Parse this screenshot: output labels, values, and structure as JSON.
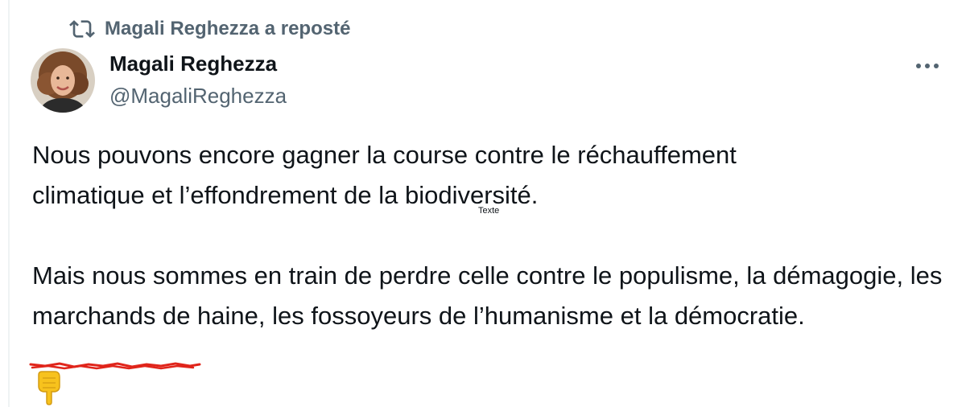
{
  "repost": {
    "icon": "repost-icon",
    "text": "Magali Reghezza a reposté"
  },
  "author": {
    "avatar": "avatar",
    "name": "Magali Reghezza",
    "handle": "@MagaliReghezza"
  },
  "actions": {
    "more_icon": "more-icon"
  },
  "tweet": {
    "line1": "Nous pouvons encore gagner la course contre le réchauffement",
    "line2": "climatique et l’effondrement de la biodiversité.",
    "para2_lead": "Mais nous sommes en train de perdre celle contre le populisme, la démagogie, les marchands de haine, les fossoyeurs de l’humanisme et la ",
    "para2_last": "démocratie."
  },
  "overlay_label": "Texte",
  "annotations": {
    "underline_icon": "red-scribble-underline",
    "pointer_icon": "pointing-down-emoji-icon",
    "underline_color": "#e0251b"
  },
  "colors": {
    "text": "#0f1419",
    "secondary": "#536471",
    "border": "#eff3f4"
  }
}
